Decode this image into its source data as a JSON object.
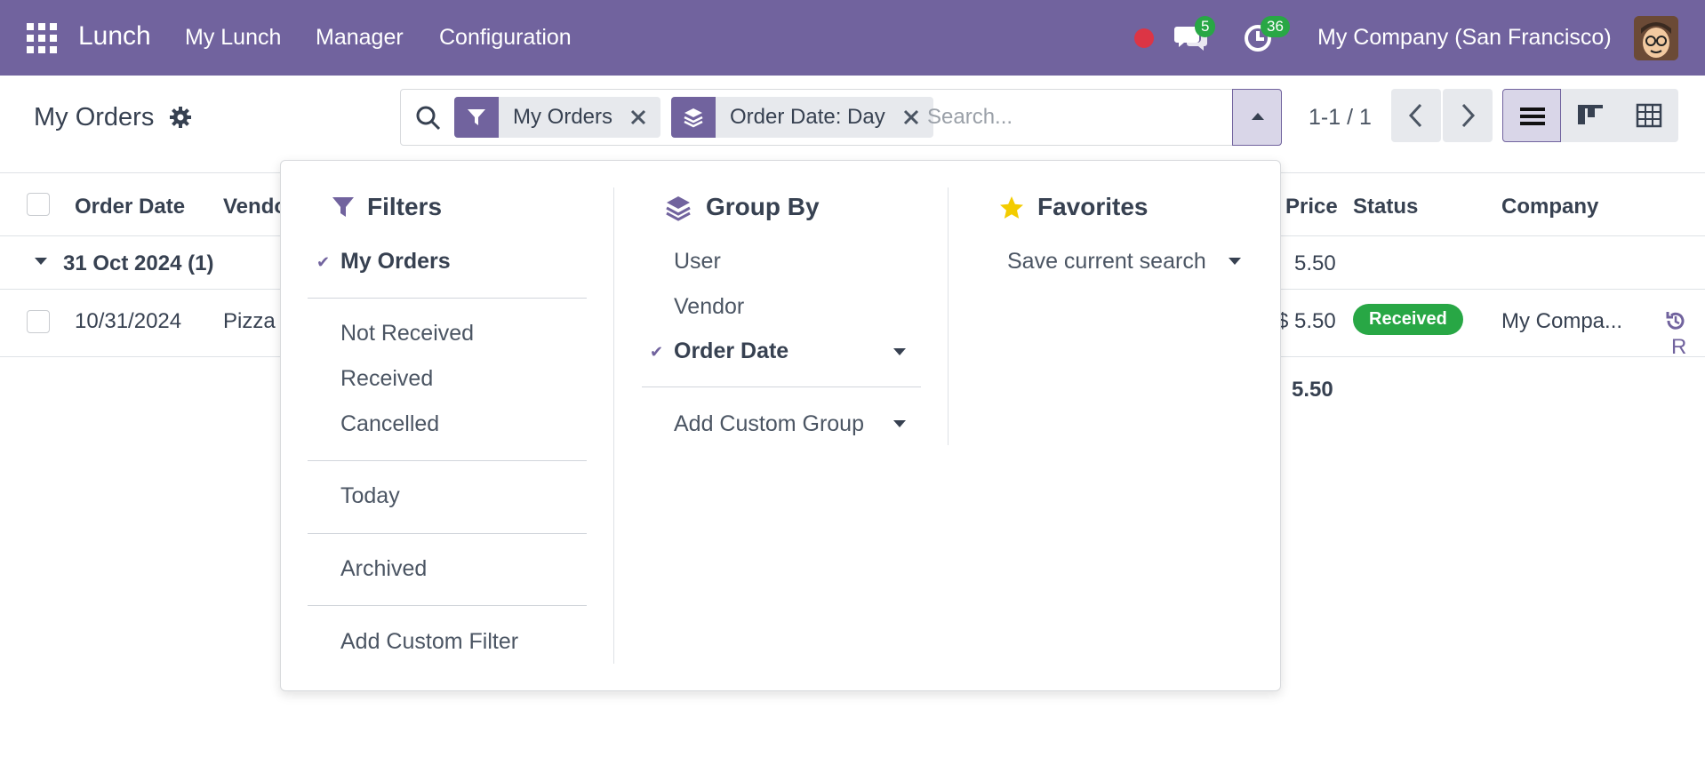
{
  "navbar": {
    "app_name": "Lunch",
    "menu": [
      "My Lunch",
      "Manager",
      "Configuration"
    ],
    "chat_count": "5",
    "activity_count": "36",
    "company": "My Company (San Francisco)"
  },
  "control_panel": {
    "title": "My Orders",
    "search": {
      "facets": [
        {
          "label": "My Orders",
          "icon": "filter-icon"
        },
        {
          "label": "Order Date: Day",
          "icon": "layers-icon"
        }
      ],
      "placeholder": "Search..."
    },
    "pager": "1-1 / 1"
  },
  "list": {
    "headers": {
      "order_date": "Order Date",
      "vendor": "Vendo",
      "price": "Price",
      "status": "Status",
      "company": "Company"
    },
    "group": {
      "label": "31 Oct 2024 (1)",
      "total": "5.50"
    },
    "row": {
      "order_date": "10/31/2024",
      "vendor": "Pizza",
      "price": "$ 5.50",
      "status": "Received",
      "company": "My Compa...",
      "action": "R"
    },
    "footer_total": "5.50"
  },
  "dropdown": {
    "filters": {
      "title": "Filters",
      "items": [
        "My Orders",
        "Not Received",
        "Received",
        "Cancelled",
        "Today",
        "Archived",
        "Add Custom Filter"
      ]
    },
    "group_by": {
      "title": "Group By",
      "items": [
        "User",
        "Vendor",
        "Order Date",
        "Add Custom Group"
      ]
    },
    "favorites": {
      "title": "Favorites",
      "items": [
        "Save current search"
      ]
    }
  },
  "colors": {
    "brand": "#71639e",
    "success": "#28a745",
    "danger": "#dc3545",
    "star": "#f3cc00"
  }
}
